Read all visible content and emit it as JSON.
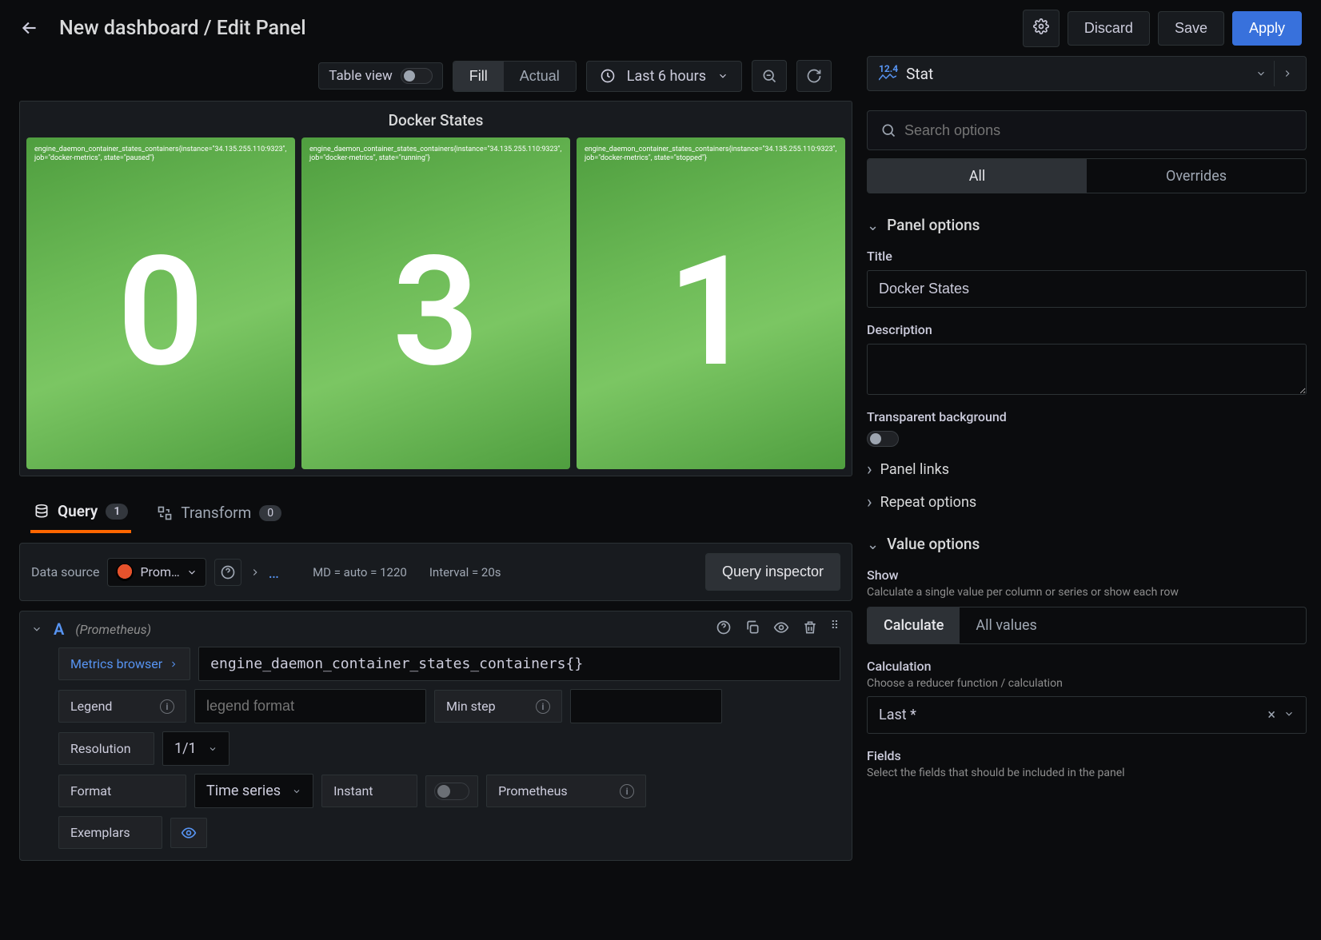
{
  "header": {
    "title": "New dashboard / Edit Panel",
    "buttons": {
      "discard": "Discard",
      "save": "Save",
      "apply": "Apply"
    }
  },
  "toolbar": {
    "table_view_label": "Table view",
    "fill_label": "Fill",
    "actual_label": "Actual",
    "range_label": "Last 6 hours"
  },
  "viz_type": "Stat",
  "panel": {
    "title": "Docker States",
    "stats": [
      {
        "legend": "engine_daemon_container_states_containers{instance=\"34.135.255.110:9323\", job=\"docker-metrics\", state=\"paused\"}",
        "value": "0"
      },
      {
        "legend": "engine_daemon_container_states_containers{instance=\"34.135.255.110:9323\", job=\"docker-metrics\", state=\"running\"}",
        "value": "3"
      },
      {
        "legend": "engine_daemon_container_states_containers{instance=\"34.135.255.110:9323\", job=\"docker-metrics\", state=\"stopped\"}",
        "value": "1"
      }
    ]
  },
  "tabs": {
    "query_label": "Query",
    "query_count": "1",
    "transform_label": "Transform",
    "transform_count": "0"
  },
  "datasource": {
    "label": "Data source",
    "name": "Prom…",
    "md_info": "MD = auto = 1220",
    "interval_info": "Interval = 20s",
    "inspector_btn": "Query inspector"
  },
  "query_row": {
    "letter": "A",
    "ds_name": "(Prometheus)",
    "metrics_browser": "Metrics browser",
    "expression": "engine_daemon_container_states_containers{}",
    "legend_label": "Legend",
    "legend_placeholder": "legend format",
    "minstep_label": "Min step",
    "resolution_label": "Resolution",
    "resolution_value": "1/1",
    "format_label": "Format",
    "format_value": "Time series",
    "instant_label": "Instant",
    "prometheus_label": "Prometheus",
    "exemplars_label": "Exemplars"
  },
  "options": {
    "search_placeholder": "Search options",
    "tab_all": "All",
    "tab_overrides": "Overrides",
    "panel_options_hd": "Panel options",
    "title_label": "Title",
    "title_value": "Docker States",
    "description_label": "Description",
    "transparent_label": "Transparent background",
    "panel_links_hd": "Panel links",
    "repeat_hd": "Repeat options",
    "value_options_hd": "Value options",
    "show_label": "Show",
    "show_help": "Calculate a single value per column or series or show each row",
    "calc_btn": "Calculate",
    "allvals_btn": "All values",
    "calculation_label": "Calculation",
    "calculation_help": "Choose a reducer function / calculation",
    "calculation_value": "Last *",
    "fields_label": "Fields",
    "fields_help": "Select the fields that should be included in the panel"
  }
}
